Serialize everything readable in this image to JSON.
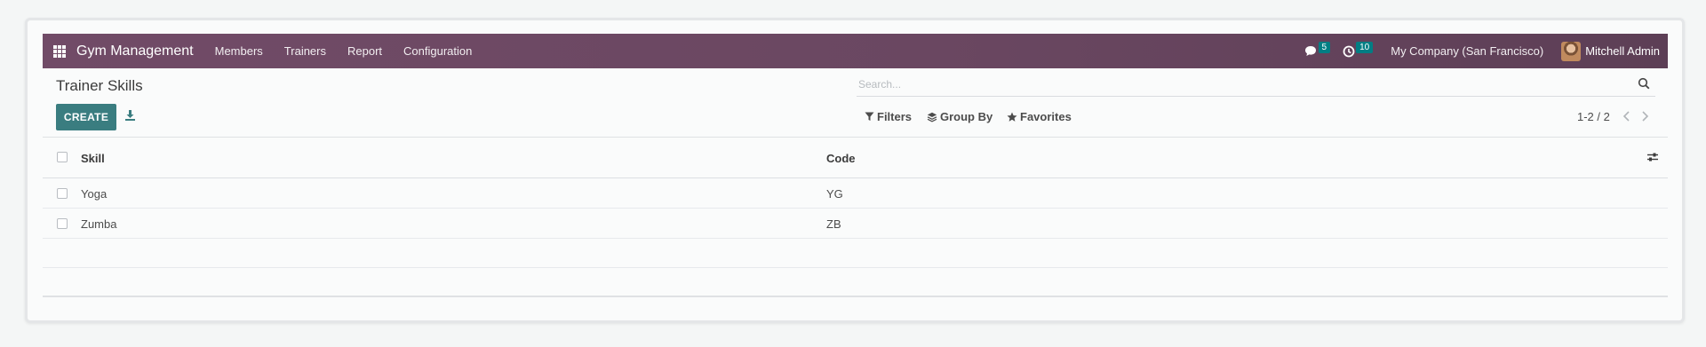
{
  "navbar": {
    "brand": "Gym Management",
    "menus": [
      "Members",
      "Trainers",
      "Report",
      "Configuration"
    ],
    "messages_count": "5",
    "activities_count": "10",
    "company": "My Company (San Francisco)",
    "user": "Mitchell Admin"
  },
  "page": {
    "title": "Trainer Skills",
    "create_label": "CREATE"
  },
  "search": {
    "placeholder": "Search..."
  },
  "filters": {
    "filters_label": "Filters",
    "group_by_label": "Group By",
    "favorites_label": "Favorites"
  },
  "pager": {
    "text": "1-2 / 2"
  },
  "table": {
    "columns": [
      "Skill",
      "Code"
    ],
    "rows": [
      {
        "skill": "Yoga",
        "code": "YG"
      },
      {
        "skill": "Zumba",
        "code": "ZB"
      }
    ]
  },
  "colors": {
    "navbar": "#714b67",
    "primary_button": "#3a7d80",
    "badge": "#017e84"
  }
}
